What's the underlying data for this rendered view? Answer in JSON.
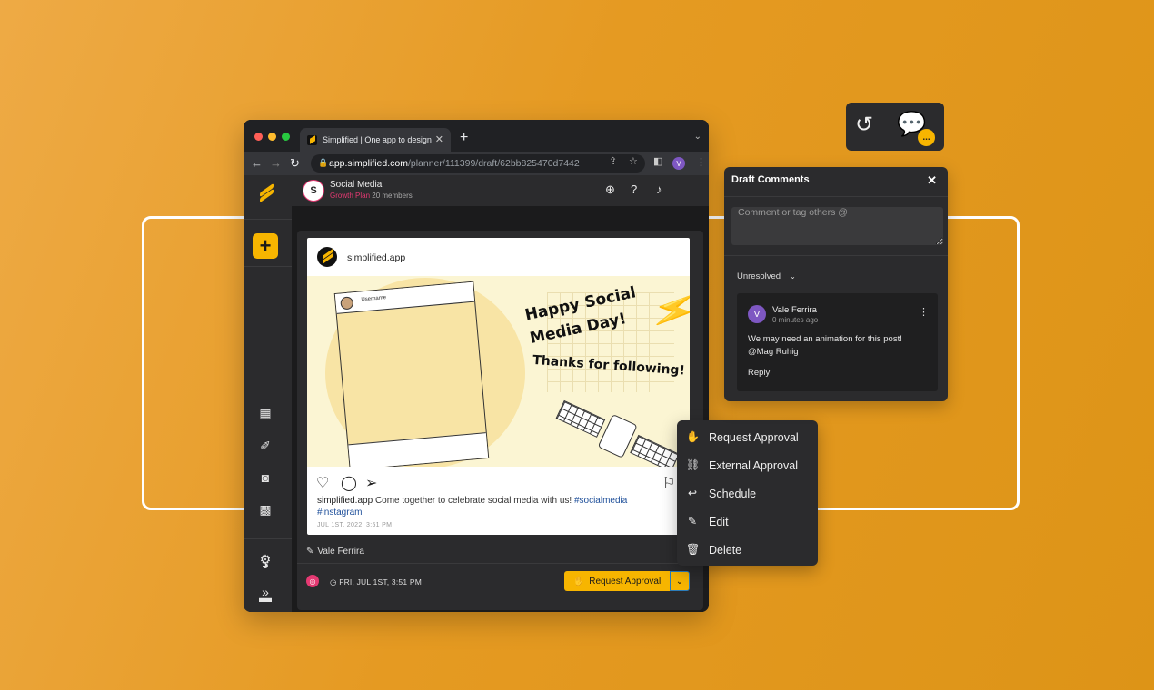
{
  "browser": {
    "tab_title": "Simplified | One app to design,",
    "url_host": "app.simplified.com",
    "url_path": "/planner/111399/draft/62bb825470d7442",
    "profile_initial": "V"
  },
  "header": {
    "workspace_initial": "S",
    "workspace_name": "Social Media",
    "plan": "Growth Plan",
    "members": "20 members"
  },
  "sidebar": {
    "items": [
      {
        "icon": "dashboard-icon"
      },
      {
        "icon": "design-tools-icon"
      },
      {
        "icon": "ai-robot-icon"
      },
      {
        "icon": "calendar-icon"
      },
      {
        "icon": "palette-icon"
      },
      {
        "icon": "folder-icon"
      },
      {
        "icon": "gear-icon"
      },
      {
        "icon": "expand-icon"
      }
    ]
  },
  "post": {
    "account": "simplified.app",
    "art_username": "Username",
    "art_line1": "Happy Social",
    "art_line2": "Media Day!",
    "art_line3": "Thanks for following!",
    "caption_user": "simplified.app",
    "caption_text": "Come together to celebrate social media with us!",
    "hashtag1": "#socialmedia",
    "hashtag2": "#instagram",
    "date": "JUL 1ST, 2022, 3:51 PM"
  },
  "footer": {
    "author": "Vale Ferrira",
    "schedule": "FRI, JUL 1ST, 3:51 PM",
    "request_label": "Request Approval"
  },
  "menu": {
    "items": [
      {
        "label": "Request Approval",
        "icon": "hand-icon"
      },
      {
        "label": "External Approval",
        "icon": "link-icon"
      },
      {
        "label": "Schedule",
        "icon": "reply-icon"
      },
      {
        "label": "Edit",
        "icon": "pencil-icon"
      },
      {
        "label": "Delete",
        "icon": "trash-icon"
      }
    ]
  },
  "comments": {
    "title": "Draft Comments",
    "placeholder": "Comment or tag others @",
    "filter": "Unresolved",
    "badge": "...",
    "item": {
      "initial": "V",
      "author": "Vale Ferrira",
      "time": "0 minutes ago",
      "text1": "We may need an animation for this post!",
      "text2": "@Mag Ruhig",
      "reply": "Reply"
    }
  },
  "colors": {
    "accent": "#f7b500",
    "brand_pink": "#e53972",
    "avatar_purple": "#7e57c2",
    "background": "#e59a22"
  }
}
